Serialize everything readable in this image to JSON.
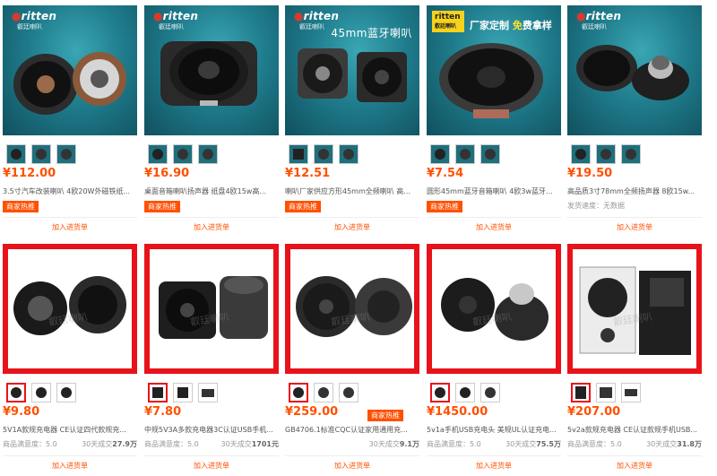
{
  "rows": [
    {
      "products": [
        {
          "style": "teal",
          "brand": "ritten",
          "brand_sub": "叡廷喇叭",
          "banner_text": "",
          "promo": null,
          "price": "¥112.00",
          "title": "3.5寸汽车改装喇叭 4欧20W外磁铁纸...",
          "badge": "商家热推",
          "delivery": "",
          "stats": null,
          "add_label": "加入进货单"
        },
        {
          "style": "teal",
          "brand": "ritten",
          "brand_sub": "叡廷喇叭",
          "banner_text": "",
          "promo": null,
          "price": "¥16.90",
          "title": "桌面音箱喇叭扬声器 纸盘4欧15w高...",
          "badge": "商家热推",
          "delivery": "",
          "stats": null,
          "add_label": "加入进货单"
        },
        {
          "style": "teal",
          "brand": "ritten",
          "brand_sub": "叡廷喇叭",
          "banner_text": "45mm蓝牙喇叭",
          "promo": null,
          "price": "¥12.51",
          "title": "喇叭厂家供应方形45mm全频喇叭 高...",
          "badge": "商家热推",
          "delivery": "",
          "stats": null,
          "add_label": "加入进货单"
        },
        {
          "style": "teal",
          "brand": "",
          "brand_sub": "",
          "banner_text": "",
          "promo": {
            "logo": "ritten",
            "logo_sub": "叡廷喇叭",
            "text_before": "厂家定制 ",
            "text_highlight": "免",
            "text_after": "费拿样"
          },
          "price": "¥7.54",
          "title": "圆形45mm蓝牙音箱喇叭 4欧3w蓝牙...",
          "badge": "商家热推",
          "delivery": "",
          "stats": null,
          "add_label": "加入进货单"
        },
        {
          "style": "teal",
          "brand": "ritten",
          "brand_sub": "叡廷喇叭",
          "banner_text": "",
          "promo": null,
          "price": "¥19.50",
          "title": "高品质3寸78mm全频扬声器 8欧15w...",
          "badge": "",
          "delivery": "发货速度：无数据",
          "stats": null,
          "add_label": "加入进货单"
        }
      ]
    },
    {
      "products": [
        {
          "style": "red",
          "watermark": "叡廷喇叭",
          "price": "¥9.80",
          "title": "5V1A款规充电器 CE认证四代款规充...",
          "badge": "",
          "delivery": "",
          "stats": {
            "left": "商品满意度：5.0",
            "right_label": "30天成交",
            "right_value": "27.9万"
          },
          "add_label": "加入进货单"
        },
        {
          "style": "red",
          "watermark": "叡廷喇叭",
          "price": "¥7.80",
          "title": "中规5V3A多款充电器3C认证USB手机...",
          "badge": "",
          "delivery": "",
          "stats": {
            "left": "商品满意度：5.0",
            "right_label": "30天成交",
            "right_value": "1701元"
          },
          "add_label": "加入进货单"
        },
        {
          "style": "red",
          "watermark": "叡廷喇叭",
          "price": "¥259.00",
          "title": "GB4706.1标准CQC认证家用通用充...",
          "badge": "商家热推",
          "delivery": "",
          "stats": {
            "left": "",
            "right_label": "30天成交",
            "right_value": "9.1万"
          },
          "add_label": "加入进货单"
        },
        {
          "style": "red",
          "watermark": "叡廷喇叭",
          "price": "¥1450.00",
          "title": "5v1a手机USB充电头 美规UL认证充电...",
          "badge": "",
          "delivery": "",
          "stats": {
            "left": "商品满意度：5.0",
            "right_label": "30天成交",
            "right_value": "75.5万"
          },
          "add_label": "加入进货单"
        },
        {
          "style": "red",
          "watermark": "叡廷喇叭",
          "price": "¥207.00",
          "title": "5v2a款规充电器 CE认证款规手机USB...",
          "badge": "",
          "delivery": "",
          "stats": {
            "left": "商品满意度：5.0",
            "right_label": "30天成交",
            "right_value": "31.8万"
          },
          "add_label": "加入进货单"
        }
      ]
    }
  ],
  "colors": {
    "accent": "#ff5000",
    "frame_red": "#e8121b",
    "teal": "#1f7c8c"
  }
}
